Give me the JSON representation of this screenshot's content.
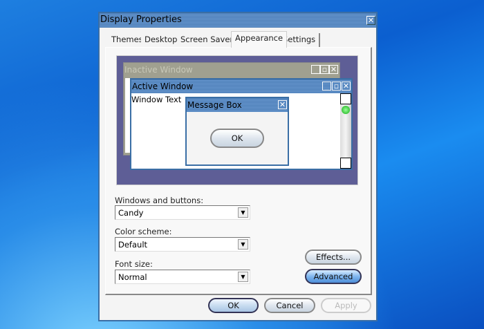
{
  "window": {
    "title": "Display Properties",
    "close": "✕"
  },
  "tabs": [
    "Themes",
    "Desktop",
    "Screen Saver",
    "Appearance",
    "Settings"
  ],
  "active_tab": "Appearance",
  "preview": {
    "inactive_title": "Inactive Window",
    "active_title": "Active Window",
    "window_text": "Window Text",
    "message_title": "Message Box",
    "message_ok": "OK",
    "min": "_",
    "max": "▫",
    "close": "✕"
  },
  "fields": [
    {
      "label": "Windows and buttons:",
      "value": "Candy"
    },
    {
      "label": "Color scheme:",
      "value": "Default"
    },
    {
      "label": "Font size:",
      "value": "Normal"
    }
  ],
  "arrow": "▼",
  "buttons": {
    "effects": "Effects...",
    "advanced": "Advanced",
    "ok": "OK",
    "cancel": "Cancel",
    "apply": "Apply"
  }
}
